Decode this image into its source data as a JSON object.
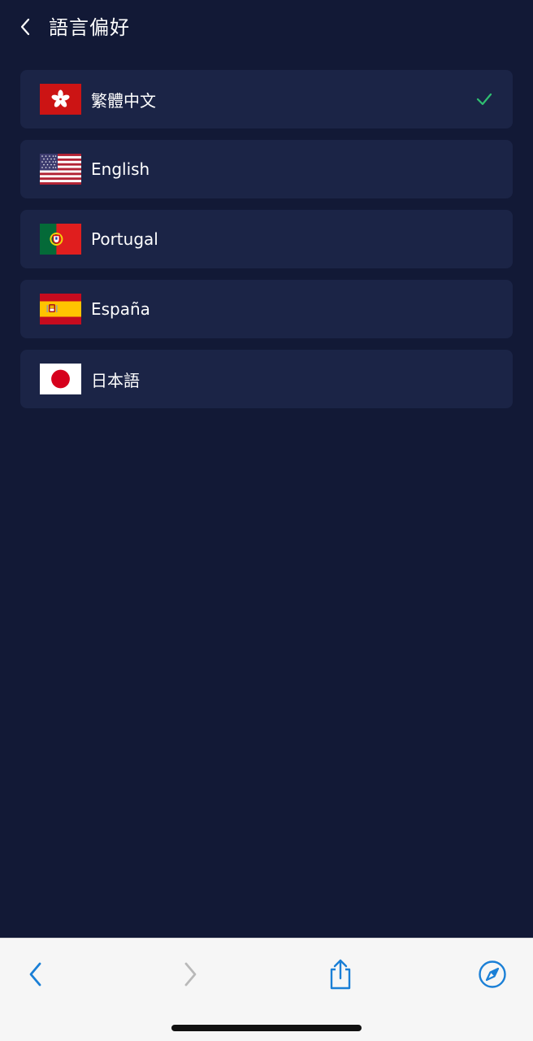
{
  "header": {
    "title": "語言偏好",
    "back_icon": "chevron-left-icon"
  },
  "languages": [
    {
      "label": "繁體中文",
      "flag": "hong-kong-flag-icon",
      "selected": true
    },
    {
      "label": "English",
      "flag": "usa-flag-icon",
      "selected": false
    },
    {
      "label": "Portugal",
      "flag": "portugal-flag-icon",
      "selected": false
    },
    {
      "label": "España",
      "flag": "spain-flag-icon",
      "selected": false
    },
    {
      "label": "日本語",
      "flag": "japan-flag-icon",
      "selected": false
    }
  ],
  "toolbar": {
    "back_icon": "browser-back-icon",
    "forward_icon": "browser-forward-icon",
    "share_icon": "share-icon",
    "compass_icon": "compass-icon"
  },
  "colors": {
    "background": "#121936",
    "card": "#1b2446",
    "check": "#2fbf71",
    "toolbar_accent": "#1a7fd6",
    "toolbar_disabled": "#b9b9b9"
  }
}
